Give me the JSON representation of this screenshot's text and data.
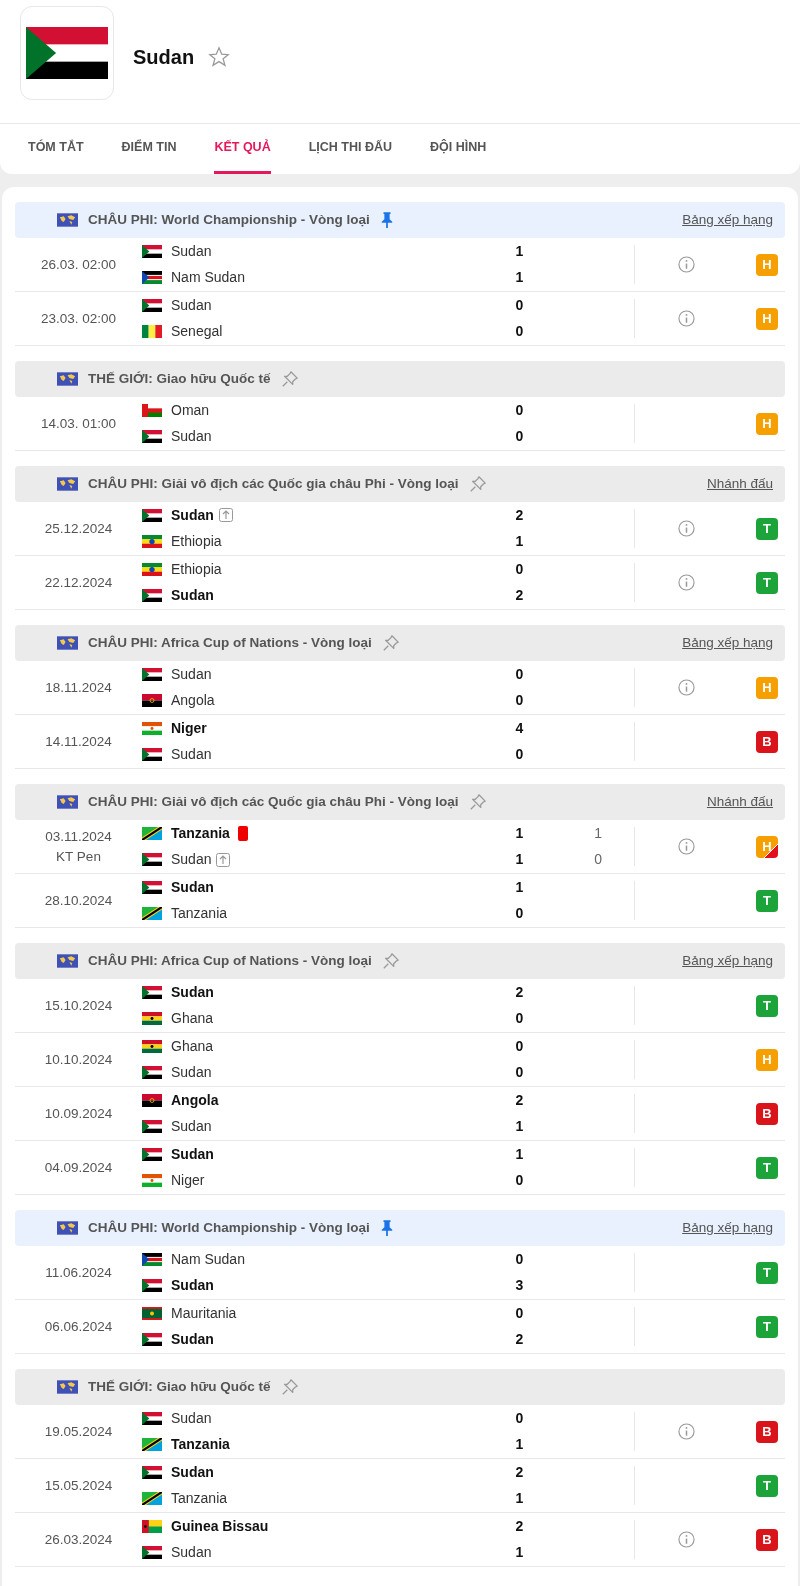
{
  "team": {
    "name": "Sudan",
    "kind": "sd",
    "favorite": false
  },
  "tabs": [
    {
      "label": "TÓM TẮT",
      "selected": false
    },
    {
      "label": "ĐIỂM TIN",
      "selected": false
    },
    {
      "label": "KẾT QUẢ",
      "selected": true
    },
    {
      "label": "LỊCH THI ĐẤU",
      "selected": false
    },
    {
      "label": "ĐỘI HÌNH",
      "selected": false
    }
  ],
  "groups": [
    {
      "title": "CHÂU PHI: World Championship - Vòng loại",
      "pinned": true,
      "link": "Bảng xếp hạng",
      "matches": [
        {
          "date": "26.03. 02:00",
          "info": true,
          "result": {
            "letter": "H",
            "color": "#f5a000",
            "split": false
          },
          "teams": [
            {
              "name": "Sudan",
              "kind": "sd",
              "bold": false,
              "red_card": false,
              "advanced": false,
              "score": "1"
            },
            {
              "name": "Nam Sudan",
              "kind": "ss",
              "bold": false,
              "red_card": false,
              "advanced": false,
              "score": "1"
            }
          ]
        },
        {
          "date": "23.03. 02:00",
          "info": true,
          "result": {
            "letter": "H",
            "color": "#f5a000",
            "split": false
          },
          "teams": [
            {
              "name": "Sudan",
              "kind": "sd",
              "bold": false,
              "red_card": false,
              "advanced": false,
              "score": "0"
            },
            {
              "name": "Senegal",
              "kind": "sn",
              "bold": false,
              "red_card": false,
              "advanced": false,
              "score": "0"
            }
          ]
        }
      ]
    },
    {
      "title": "THẾ GIỚI: Giao hữu Quốc tế",
      "pinned": false,
      "matches": [
        {
          "date": "14.03. 01:00",
          "info": false,
          "result": {
            "letter": "H",
            "color": "#f5a000",
            "split": false
          },
          "teams": [
            {
              "name": "Oman",
              "kind": "om",
              "bold": false,
              "red_card": false,
              "advanced": false,
              "score": "0"
            },
            {
              "name": "Sudan",
              "kind": "sd",
              "bold": false,
              "red_card": false,
              "advanced": false,
              "score": "0"
            }
          ]
        }
      ]
    },
    {
      "title": "CHÂU PHI: Giải vô địch các Quốc gia châu Phi - Vòng loại",
      "pinned": false,
      "link": "Nhánh đấu",
      "matches": [
        {
          "date": "25.12.2024",
          "info": true,
          "result": {
            "letter": "T",
            "color": "#1ca33a",
            "split": false
          },
          "teams": [
            {
              "name": "Sudan",
              "kind": "sd",
              "bold": true,
              "red_card": false,
              "advanced": true,
              "score": "2"
            },
            {
              "name": "Ethiopia",
              "kind": "et",
              "bold": false,
              "red_card": false,
              "advanced": false,
              "score": "1"
            }
          ]
        },
        {
          "date": "22.12.2024",
          "info": true,
          "result": {
            "letter": "T",
            "color": "#1ca33a",
            "split": false
          },
          "teams": [
            {
              "name": "Ethiopia",
              "kind": "et",
              "bold": false,
              "red_card": false,
              "advanced": false,
              "score": "0"
            },
            {
              "name": "Sudan",
              "kind": "sd",
              "bold": true,
              "red_card": false,
              "advanced": false,
              "score": "2"
            }
          ]
        }
      ]
    },
    {
      "title": "CHÂU PHI: Africa Cup of Nations - Vòng loại",
      "pinned": false,
      "link": "Bảng xếp hạng",
      "matches": [
        {
          "date": "18.11.2024",
          "info": true,
          "result": {
            "letter": "H",
            "color": "#f5a000",
            "split": false
          },
          "teams": [
            {
              "name": "Sudan",
              "kind": "sd",
              "bold": false,
              "red_card": false,
              "advanced": false,
              "score": "0"
            },
            {
              "name": "Angola",
              "kind": "ao",
              "bold": false,
              "red_card": false,
              "advanced": false,
              "score": "0"
            }
          ]
        },
        {
          "date": "14.11.2024",
          "info": false,
          "result": {
            "letter": "B",
            "color": "#d9141a",
            "split": false
          },
          "teams": [
            {
              "name": "Niger",
              "kind": "ne",
              "bold": true,
              "red_card": false,
              "advanced": false,
              "score": "4"
            },
            {
              "name": "Sudan",
              "kind": "sd",
              "bold": false,
              "red_card": false,
              "advanced": false,
              "score": "0"
            }
          ]
        }
      ]
    },
    {
      "title": "CHÂU PHI: Giải vô địch các Quốc gia châu Phi - Vòng loại",
      "pinned": false,
      "link": "Nhánh đấu",
      "matches": [
        {
          "date": "03.11.2024",
          "note": "KT Pen",
          "info": true,
          "result": {
            "letter": "H",
            "color": "#f5a000",
            "split": true
          },
          "teams": [
            {
              "name": "Tanzania",
              "kind": "tz",
              "bold": true,
              "red_card": true,
              "advanced": false,
              "score": "1",
              "pen": "1"
            },
            {
              "name": "Sudan",
              "kind": "sd",
              "bold": false,
              "red_card": false,
              "advanced": true,
              "score": "1",
              "pen": "0"
            }
          ]
        },
        {
          "date": "28.10.2024",
          "info": false,
          "result": {
            "letter": "T",
            "color": "#1ca33a",
            "split": false
          },
          "teams": [
            {
              "name": "Sudan",
              "kind": "sd",
              "bold": true,
              "red_card": false,
              "advanced": false,
              "score": "1"
            },
            {
              "name": "Tanzania",
              "kind": "tz",
              "bold": false,
              "red_card": false,
              "advanced": false,
              "score": "0"
            }
          ]
        }
      ]
    },
    {
      "title": "CHÂU PHI: Africa Cup of Nations - Vòng loại",
      "pinned": false,
      "link": "Bảng xếp hạng",
      "matches": [
        {
          "date": "15.10.2024",
          "info": false,
          "result": {
            "letter": "T",
            "color": "#1ca33a",
            "split": false
          },
          "teams": [
            {
              "name": "Sudan",
              "kind": "sd",
              "bold": true,
              "red_card": false,
              "advanced": false,
              "score": "2"
            },
            {
              "name": "Ghana",
              "kind": "gh",
              "bold": false,
              "red_card": false,
              "advanced": false,
              "score": "0"
            }
          ]
        },
        {
          "date": "10.10.2024",
          "info": false,
          "result": {
            "letter": "H",
            "color": "#f5a000",
            "split": false
          },
          "teams": [
            {
              "name": "Ghana",
              "kind": "gh",
              "bold": false,
              "red_card": false,
              "advanced": false,
              "score": "0"
            },
            {
              "name": "Sudan",
              "kind": "sd",
              "bold": false,
              "red_card": false,
              "advanced": false,
              "score": "0"
            }
          ]
        },
        {
          "date": "10.09.2024",
          "info": false,
          "result": {
            "letter": "B",
            "color": "#d9141a",
            "split": false
          },
          "teams": [
            {
              "name": "Angola",
              "kind": "ao",
              "bold": true,
              "red_card": false,
              "advanced": false,
              "score": "2"
            },
            {
              "name": "Sudan",
              "kind": "sd",
              "bold": false,
              "red_card": false,
              "advanced": false,
              "score": "1"
            }
          ]
        },
        {
          "date": "04.09.2024",
          "info": false,
          "result": {
            "letter": "T",
            "color": "#1ca33a",
            "split": false
          },
          "teams": [
            {
              "name": "Sudan",
              "kind": "sd",
              "bold": true,
              "red_card": false,
              "advanced": false,
              "score": "1"
            },
            {
              "name": "Niger",
              "kind": "ne",
              "bold": false,
              "red_card": false,
              "advanced": false,
              "score": "0"
            }
          ]
        }
      ]
    },
    {
      "title": "CHÂU PHI: World Championship - Vòng loại",
      "pinned": true,
      "link": "Bảng xếp hạng",
      "matches": [
        {
          "date": "11.06.2024",
          "info": false,
          "result": {
            "letter": "T",
            "color": "#1ca33a",
            "split": false
          },
          "teams": [
            {
              "name": "Nam Sudan",
              "kind": "ss",
              "bold": false,
              "red_card": false,
              "advanced": false,
              "score": "0"
            },
            {
              "name": "Sudan",
              "kind": "sd",
              "bold": true,
              "red_card": false,
              "advanced": false,
              "score": "3"
            }
          ]
        },
        {
          "date": "06.06.2024",
          "info": false,
          "result": {
            "letter": "T",
            "color": "#1ca33a",
            "split": false
          },
          "teams": [
            {
              "name": "Mauritania",
              "kind": "mr",
              "bold": false,
              "red_card": false,
              "advanced": false,
              "score": "0"
            },
            {
              "name": "Sudan",
              "kind": "sd",
              "bold": true,
              "red_card": false,
              "advanced": false,
              "score": "2"
            }
          ]
        }
      ]
    },
    {
      "title": "THẾ GIỚI: Giao hữu Quốc tế",
      "pinned": false,
      "matches": [
        {
          "date": "19.05.2024",
          "info": true,
          "result": {
            "letter": "B",
            "color": "#d9141a",
            "split": false
          },
          "teams": [
            {
              "name": "Sudan",
              "kind": "sd",
              "bold": false,
              "red_card": false,
              "advanced": false,
              "score": "0"
            },
            {
              "name": "Tanzania",
              "kind": "tz",
              "bold": true,
              "red_card": false,
              "advanced": false,
              "score": "1"
            }
          ]
        },
        {
          "date": "15.05.2024",
          "info": false,
          "result": {
            "letter": "T",
            "color": "#1ca33a",
            "split": false
          },
          "teams": [
            {
              "name": "Sudan",
              "kind": "sd",
              "bold": true,
              "red_card": false,
              "advanced": false,
              "score": "2"
            },
            {
              "name": "Tanzania",
              "kind": "tz",
              "bold": false,
              "red_card": false,
              "advanced": false,
              "score": "1"
            }
          ]
        },
        {
          "date": "26.03.2024",
          "info": true,
          "result": {
            "letter": "B",
            "color": "#d9141a",
            "split": false
          },
          "teams": [
            {
              "name": "Guinea Bissau",
              "kind": "gw",
              "bold": true,
              "red_card": false,
              "advanced": false,
              "score": "2"
            },
            {
              "name": "Sudan",
              "kind": "sd",
              "bold": false,
              "red_card": false,
              "advanced": false,
              "score": "1"
            }
          ]
        }
      ]
    }
  ]
}
